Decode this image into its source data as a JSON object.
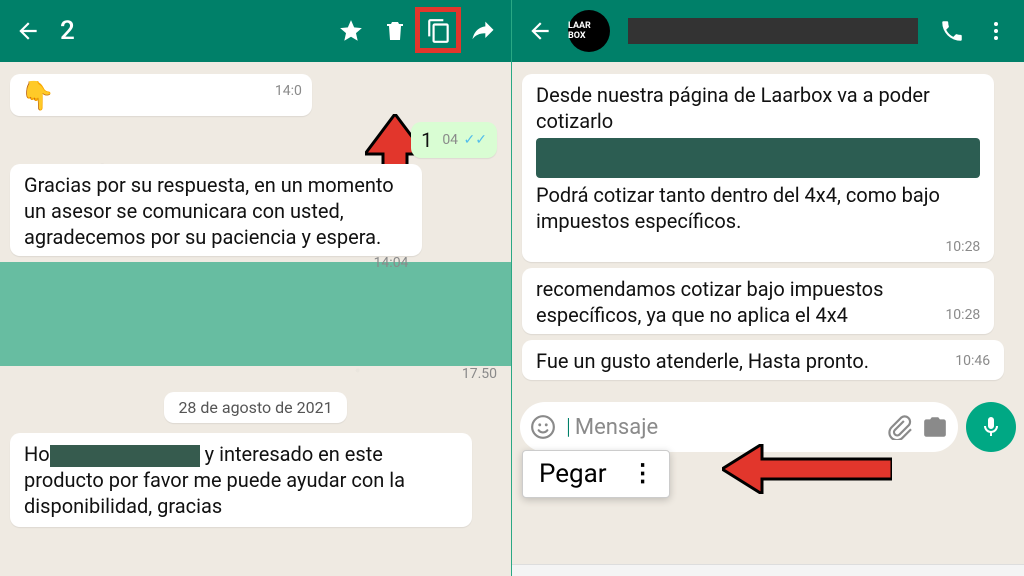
{
  "left": {
    "selection_count": "2",
    "msg_emoji": "👇",
    "msg_emoji_time": "14:0",
    "out1": "1",
    "out1_time": "04",
    "msg2": "Gracias por su respuesta, en un momento un asesor se comunicara con usted, agradecemos por su paciencia y espera.",
    "msg2_time": "14:04",
    "date_chip": "28 de agosto de 2021",
    "partial_pre": "Ho",
    "partial_post": "y interesado en este producto por favor me puede ayudar con la disponibilidad, gracias"
  },
  "right": {
    "avatar_text": "LAAR BOX",
    "msg1a": "Desde nuestra página de Laarbox va a poder cotizarlo",
    "msg1b": "Podrá cotizar tanto dentro del 4x4, como bajo impuestos específicos.",
    "msg1_time": "10:28",
    "msg2": "recomendamos cotizar bajo impuestos específicos, ya que no aplica el 4x4",
    "msg2_time": "10:28",
    "msg3": "Fue un gusto atenderle, Hasta pronto.",
    "msg3_time": "10:46",
    "paste_label": "Pegar",
    "input_placeholder": "Mensaje"
  }
}
